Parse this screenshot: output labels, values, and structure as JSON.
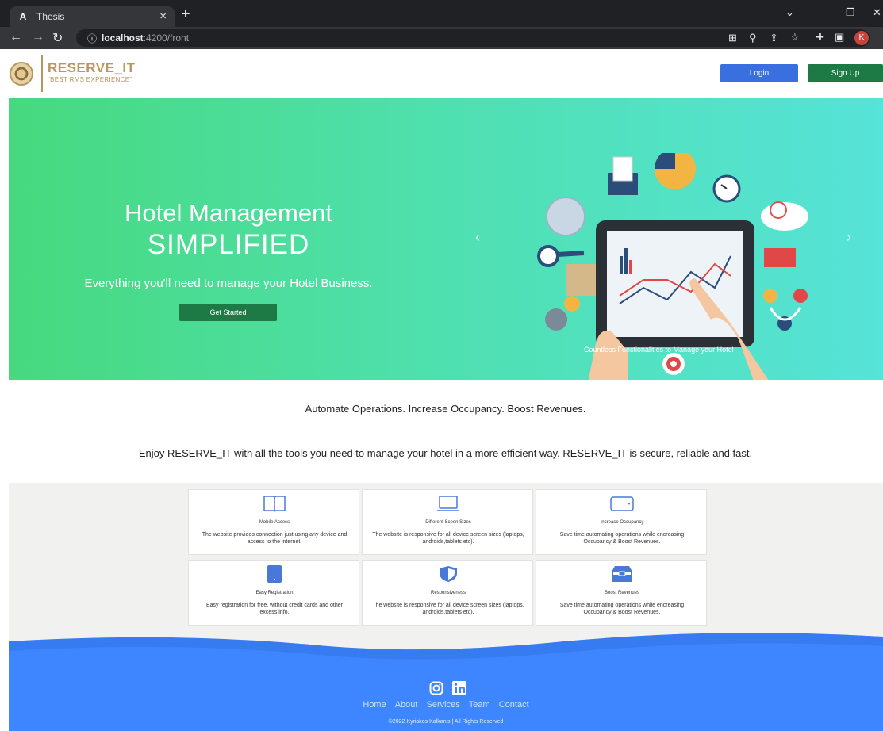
{
  "browser": {
    "tab_favicon": "A",
    "tab_title": "Thesis",
    "tab_close": "×",
    "new_tab": "+",
    "url_host": "localhost",
    "url_path": ":4200/front",
    "profile_initial": "K"
  },
  "header": {
    "brand_name": "RESERVE_IT",
    "brand_tagline": "\"BEST RMS EXPERIENCE\"",
    "login_label": "Login",
    "signup_label": "Sign Up"
  },
  "hero": {
    "title_line1": "Hotel Management",
    "title_line2": "SIMPLIFIED",
    "subtitle": "Everything you'll need to manage your Hotel Business.",
    "cta_label": "Get Started",
    "prev_icon": "‹",
    "next_icon": "›",
    "carousel_caption": "Countless Functionalities to Manage your Hotel"
  },
  "taglines": {
    "line1": "Automate Operations. Increase Occupancy. Boost Revenues.",
    "line2": "Enjoy RESERVE_IT with all the tools you need to manage your hotel in a more efficient way. RESERVE_IT is secure, reliable and fast."
  },
  "features": [
    {
      "icon": "book-icon",
      "title": "Mobile Access",
      "desc": "The website provides connection just using any device and access to the internet."
    },
    {
      "icon": "laptop-icon",
      "title": "Different Sceen Sizes",
      "desc": "The website is responsive for all device screen sizes (laptops, androids,tablets etc)."
    },
    {
      "icon": "tablet-landscape-icon",
      "title": "Increase Occupancy",
      "desc": "Save time automating operations while encreasing Occupancy & Boost Revenues."
    },
    {
      "icon": "tablet-icon",
      "title": "Easy Registration",
      "desc": "Easy registration for free, without credit cards and other excess info."
    },
    {
      "icon": "shield-icon",
      "title": "Responsiveness",
      "desc": "The website is responsive for all device screen sizes (laptops, androids,tablets etc)."
    },
    {
      "icon": "inbox-icon",
      "title": "Boost Revenues",
      "desc": "Save time automating operations while encreasing Occupancy & Boost Revenues."
    }
  ],
  "footer": {
    "links": [
      "Home",
      "About",
      "Services",
      "Team",
      "Contact"
    ],
    "copyright": "©2022 Kyriakos Kalkanis | All Rights Reserved"
  },
  "colors": {
    "brand_gold": "#b8975a",
    "login_blue": "#3a6fe0",
    "signup_green": "#1e7a45",
    "footer_blue": "#3e86ff"
  }
}
